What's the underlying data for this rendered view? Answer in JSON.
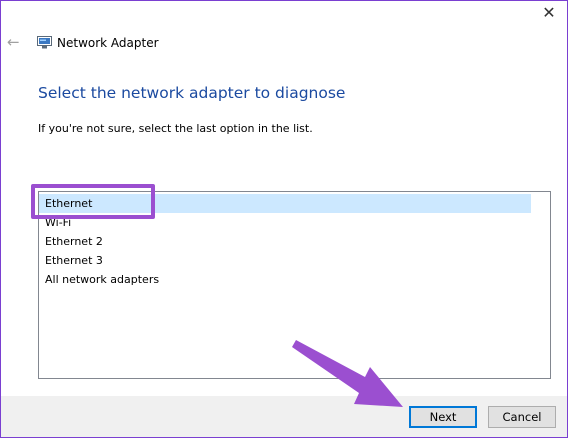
{
  "window": {
    "title": "Network Adapter",
    "close_glyph": "✕",
    "back_glyph": "←"
  },
  "main": {
    "heading": "Select the network adapter to diagnose",
    "hint": "If you're not sure, select the last option in the list."
  },
  "adapters": {
    "items": [
      {
        "label": "Ethernet",
        "selected": true
      },
      {
        "label": "Wi-Fi",
        "selected": false
      },
      {
        "label": "Ethernet 2",
        "selected": false
      },
      {
        "label": "Ethernet 3",
        "selected": false
      },
      {
        "label": "All network adapters",
        "selected": false
      }
    ]
  },
  "buttons": {
    "next": "Next",
    "cancel": "Cancel"
  },
  "colors": {
    "heading": "#1b4aa0",
    "selection": "#cce8ff",
    "annotation": "#9b4fd0",
    "frame": "#7a3fd1"
  },
  "icons": [
    "close-icon",
    "back-arrow-icon",
    "network-adapter-icon"
  ]
}
